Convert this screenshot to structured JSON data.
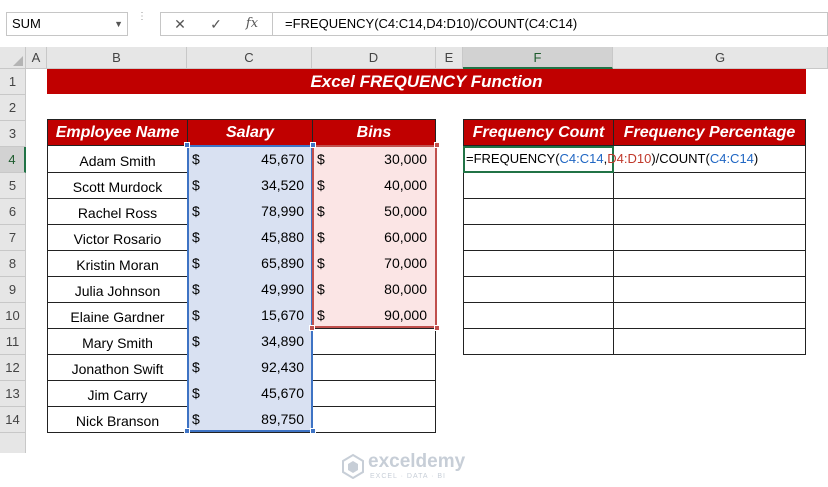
{
  "formula_bar": {
    "name_box": "SUM",
    "cancel_symbol": "✕",
    "enter_symbol": "✓",
    "fx_symbol": "fx",
    "formula": "=FREQUENCY(C4:C14,D4:D10)/COUNT(C4:C14)"
  },
  "columns": [
    "A",
    "B",
    "C",
    "D",
    "E",
    "F",
    "G"
  ],
  "rows": [
    "1",
    "2",
    "3",
    "4",
    "5",
    "6",
    "7",
    "8",
    "9",
    "10",
    "11",
    "12",
    "13",
    "14"
  ],
  "sheet": {
    "title": "Excel FREQUENCY Function",
    "headers": {
      "employee": "Employee Name",
      "salary": "Salary",
      "bins": "Bins",
      "freq_count": "Frequency Count",
      "freq_pct": "Frequency Percentage"
    },
    "currency_symbol": "$",
    "employees": [
      {
        "name": "Adam Smith",
        "salary": "45,670",
        "bin": "30,000"
      },
      {
        "name": "Scott Murdock",
        "salary": "34,520",
        "bin": "40,000"
      },
      {
        "name": "Rachel Ross",
        "salary": "78,990",
        "bin": "50,000"
      },
      {
        "name": "Victor Rosario",
        "salary": "45,880",
        "bin": "60,000"
      },
      {
        "name": "Kristin Moran",
        "salary": "65,890",
        "bin": "70,000"
      },
      {
        "name": "Julia Johnson",
        "salary": "49,990",
        "bin": "80,000"
      },
      {
        "name": "Elaine Gardner",
        "salary": "15,670",
        "bin": "90,000"
      },
      {
        "name": "Mary Smith",
        "salary": "34,890",
        "bin": ""
      },
      {
        "name": "Jonathon Swift",
        "salary": "92,430",
        "bin": ""
      },
      {
        "name": "Jim Carry",
        "salary": "45,670",
        "bin": ""
      },
      {
        "name": "Nick Branson",
        "salary": "89,750",
        "bin": ""
      }
    ],
    "editing_cell": {
      "prefix": "=FREQUENCY(",
      "ref1": "C4:C14",
      "comma": ",",
      "ref2": "D4:D10",
      "mid": ")/COUNT(",
      "ref3": "C4:C14",
      "suffix": ")"
    }
  },
  "watermark": {
    "brand": "exceldemy",
    "tagline": "EXCEL · DATA · BI"
  },
  "colors": {
    "header_red": "#c00000",
    "salary_fill": "#d9e1f2",
    "bins_fill": "#fbe5e5",
    "excel_green": "#217346"
  }
}
